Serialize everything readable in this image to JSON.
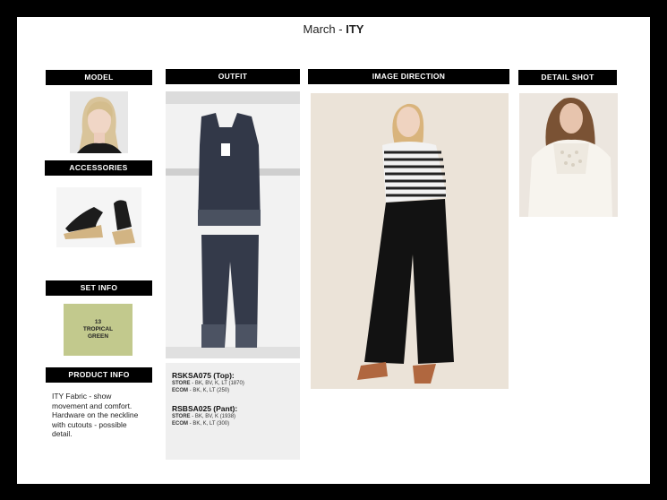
{
  "page": {
    "title_prefix": "March - ",
    "title_bold": "ITY"
  },
  "headers": {
    "model": "MODEL",
    "outfit": "OUTFIT",
    "image_direction": "IMAGE DIRECTION",
    "detail_shot": "DETAIL SHOT",
    "accessories": "ACCESSORIES",
    "set_info": "SET INFO",
    "product_info": "PRODUCT  INFO"
  },
  "set_info": {
    "swatch_text_line1": "13",
    "swatch_text_line2": "TROPICAL",
    "swatch_text_line3": "GREEN",
    "swatch_color": "#c2c98d"
  },
  "product_info": {
    "description": "ITY Fabric - show movement and comfort. Hardware on the neckline with cutouts - possible detail."
  },
  "skus": [
    {
      "code": "RSKSA075 (Top):",
      "store_label": "STORE",
      "store_value": " - BK, BV, K, LT (1870)",
      "ecom_label": "ECOM",
      "ecom_value": " - BK, K, LT (250)"
    },
    {
      "code": "RSBSA025 (Pant):",
      "store_label": "STORE",
      "store_value": " - BK, BV, K (1938)",
      "ecom_label": "ECOM",
      "ecom_value": " - BK, K, LT (300)"
    }
  ],
  "colors": {
    "header_bg": "#000000",
    "sku_panel_bg": "#efefef"
  }
}
